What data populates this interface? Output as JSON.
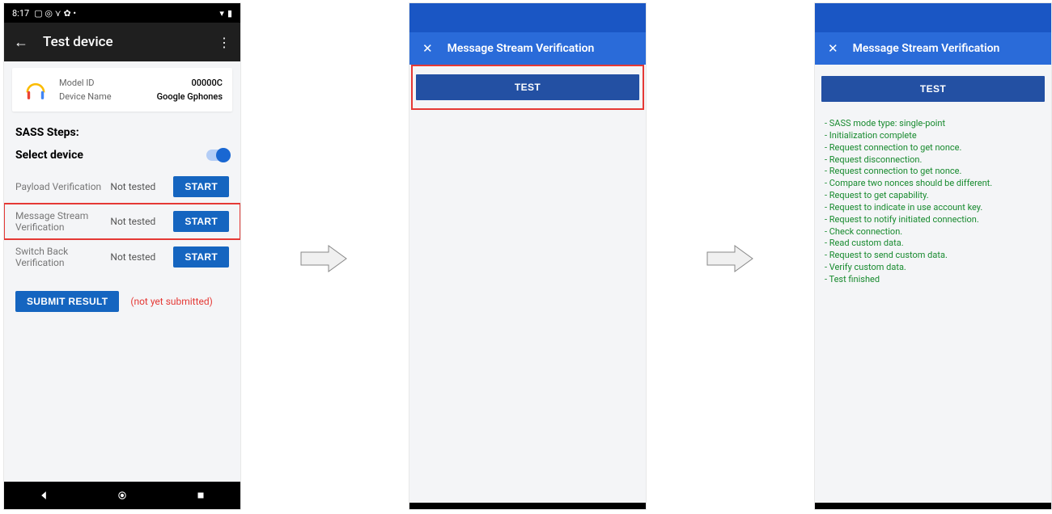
{
  "phone1": {
    "status": {
      "time": "8:17",
      "icons": "⬚ ⊙ ⋎ ⚙ •",
      "right": "♥ ⌁"
    },
    "appbar": {
      "title": "Test device"
    },
    "card": {
      "model_label": "Model ID",
      "model_value": "00000C",
      "name_label": "Device Name",
      "name_value": "Google Gphones"
    },
    "sass_title": "SASS Steps:",
    "select_label": "Select device",
    "rows": [
      {
        "name": "Payload Verification",
        "status": "Not tested",
        "btn": "START"
      },
      {
        "name": "Message Stream Verification",
        "status": "Not tested",
        "btn": "START"
      },
      {
        "name": "Switch Back Verification",
        "status": "Not tested",
        "btn": "START"
      }
    ],
    "submit_btn": "SUBMIT RESULT",
    "submit_status": "(not yet submitted)"
  },
  "phone2": {
    "title": "Message Stream Verification",
    "test_btn": "TEST"
  },
  "phone3": {
    "title": "Message Stream Verification",
    "test_btn": "TEST",
    "log": [
      "- SASS mode type: single-point",
      "- Initialization complete",
      "- Request connection to get nonce.",
      "- Request disconnection.",
      "- Request connection to get nonce.",
      "- Compare two nonces should be different.",
      "- Request to get capability.",
      "- Request to indicate in use account key.",
      "- Request to notify initiated connection.",
      "- Check connection.",
      "- Read custom data.",
      "- Request to send custom data.",
      "- Verify custom data.",
      "- Test finished"
    ]
  }
}
